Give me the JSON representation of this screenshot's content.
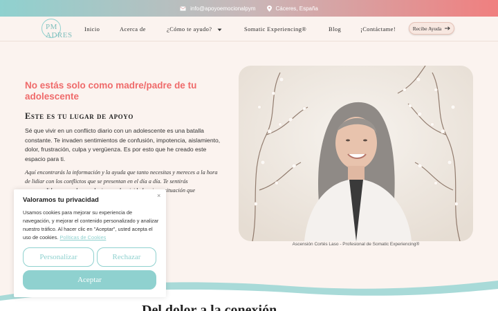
{
  "topbar": {
    "email": "info@apoyoemocionalpym",
    "location": "Cáceres, España",
    "email_icon": "mail-icon",
    "location_icon": "location-pin-icon"
  },
  "header": {
    "logo_text": "PM ADRES",
    "nav": [
      {
        "label": "Inicio"
      },
      {
        "label": "Acerca de"
      },
      {
        "label": "¿Cómo te ayudo?"
      },
      {
        "label": "Somatic Experiencing®"
      },
      {
        "label": "Blog"
      },
      {
        "label": "¡Contáctame!"
      }
    ],
    "cta_label": "Recibe Ayuda"
  },
  "hero": {
    "title": "No estás solo como madre/padre de tu adolescente",
    "subtitle": "Este es tu lugar de apoyo",
    "paragraph": "Sé que vivir en un conflicto diario con un adolescente es una batalla constante. Te invaden sentimientos de confusión, impotencia, aislamiento, dolor, frustración, culpa y vergüenza. Es por esto que he creado este espacio para ti.",
    "italic": "Aquí encontrarás la información y la ayuda que tanto necesitas y mereces a la hora de lidiar con los conflictos que se presentan en el día a día. Te sentirás comprendido y apoyado por alguien que ha vivido la misma situación que",
    "photo_caption": "Ascensión Cortés Laso - Profesional de Somatic Experiencing®"
  },
  "bottom": {
    "title": "Del dolor a la conexión"
  },
  "cookie": {
    "title": "Valoramos tu privacidad",
    "text": "Usamos cookies para mejorar su experiencia de navegación, y mejorar el contenido personalizado y analizar nuestro tráfico. Al hacer clic en \"Aceptar\", usted acepta el uso de cookies.",
    "link": "Políticas de Cookies",
    "customize_label": "Personalizar",
    "reject_label": "Rechazar",
    "accept_label": "Aceptar",
    "close_glyph": "×"
  },
  "colors": {
    "accent_teal": "#8fd1cf",
    "accent_coral": "#ef6a6a",
    "background": "#fbf3ef"
  }
}
